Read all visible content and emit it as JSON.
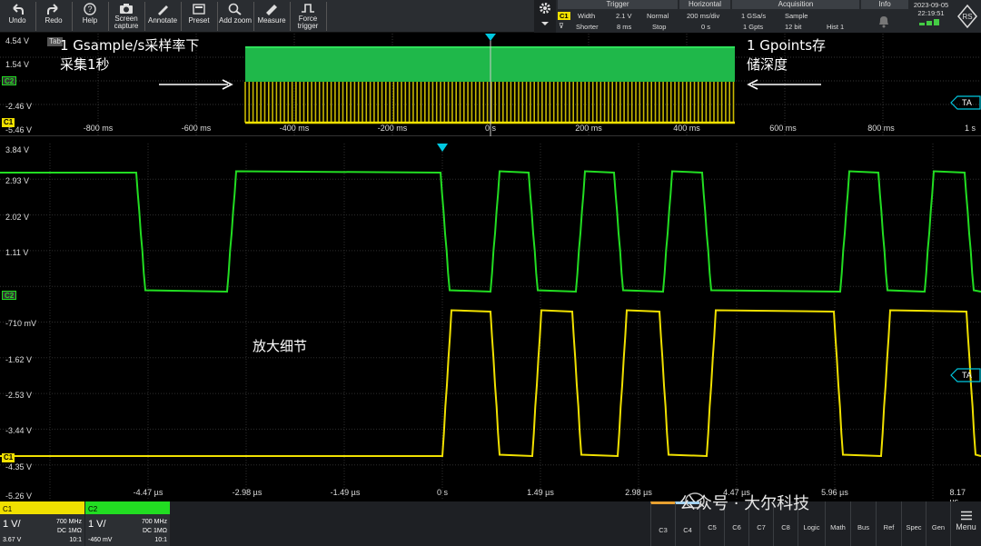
{
  "toolbar": {
    "undo": "Undo",
    "redo": "Redo",
    "help": "Help",
    "screen_capture": "Screen capture",
    "annotate": "Annotate",
    "preset": "Preset",
    "add_zoom": "Add zoom",
    "measure": "Measure",
    "force_trigger": "Force trigger"
  },
  "status": {
    "trigger": {
      "label": "Trigger",
      "source": "C1",
      "type": "Width",
      "level": "2.1 V",
      "mode": "Normal",
      "cond": "Shorter",
      "width": "8 ms",
      "state": "Stop"
    },
    "horizontal": {
      "label": "Horizontal",
      "scale": "200 ms/div",
      "pos": "0 s"
    },
    "acquisition": {
      "label": "Acquisition",
      "rate": "1 GSa/s",
      "points": "1 Gpts",
      "mode": "Sample",
      "bits": "12 bit",
      "hist": "Hist 1"
    },
    "info": "Info",
    "date": "2023-09-05",
    "time": "22:19:51"
  },
  "overview": {
    "tab": "Tab",
    "volts": [
      "4.54 V",
      "1.54 V",
      "-2.46 V",
      "-5.46 V"
    ],
    "ch_markers": [
      "C2",
      "C1"
    ],
    "times": [
      "-800 ms",
      "-600 ms",
      "-400 ms",
      "-200 ms",
      "0 s",
      "200 ms",
      "400 ms",
      "600 ms",
      "800 ms",
      "1 s"
    ],
    "ta": "TA",
    "ann_left": "1 Gsample/s采样率下\n采集1秒",
    "ann_right": "1 Gpoints存\n储深度"
  },
  "main": {
    "volts_top": [
      "3.84 V",
      "2.93 V",
      "2.02 V",
      "1.11 V"
    ],
    "volts_bottom": [
      "-710 mV",
      "-1.62 V",
      "-2.53 V",
      "-3.44 V",
      "-4.35 V",
      "-5.26 V"
    ],
    "times": [
      "-4.47 µs",
      "-2.98 µs",
      "-1.49 µs",
      "0 s",
      "1.49 µs",
      "2.98 µs",
      "4.47 µs",
      "5.96 µs",
      "8.17 µs"
    ],
    "ch_markers": [
      "C2",
      "C1"
    ],
    "ta": "TA",
    "zoom_note": "放大细节"
  },
  "channels": [
    {
      "name": "C1",
      "scale": "1 V/",
      "bw": "700 MHz",
      "coupling": "DC 1MΩ",
      "offset": "3.67 V",
      "probe": "10:1",
      "color": "#f0e000"
    },
    {
      "name": "C2",
      "scale": "1 V/",
      "bw": "700 MHz",
      "coupling": "DC 1MΩ",
      "offset": "-460 mV",
      "probe": "10:1",
      "color": "#22dd22"
    }
  ],
  "bottom_buttons": [
    "C3",
    "C4",
    "C5",
    "C6",
    "C7",
    "C8",
    "Logic",
    "Math",
    "Bus",
    "Ref",
    "Spec",
    "Gen",
    "Menu"
  ],
  "watermark": "公众号 · 大尔科技",
  "colors": {
    "ch1": "#f0e000",
    "ch2": "#22dd22",
    "ta": "#00c8e0"
  }
}
